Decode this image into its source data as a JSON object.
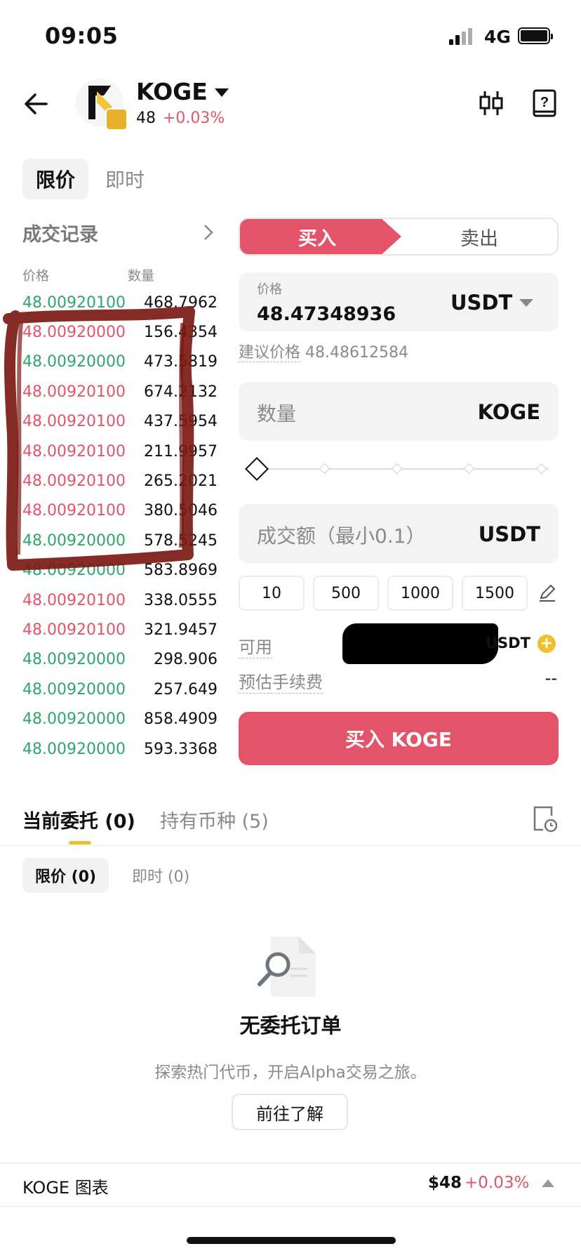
{
  "status_bar": {
    "time": "09:05",
    "network": "4G"
  },
  "header": {
    "token": "KOGE",
    "price": "48",
    "change": "+0.03%"
  },
  "order_type_tabs": {
    "limit": "限价",
    "market": "即时"
  },
  "trade_records": {
    "title": "成交记录",
    "col_price": "价格",
    "col_qty": "数量",
    "rows": [
      {
        "price": "48.00920100",
        "qty": "468.7962",
        "side": "buy"
      },
      {
        "price": "48.00920000",
        "qty": "156.4354",
        "side": "sell"
      },
      {
        "price": "48.00920000",
        "qty": "473.5819",
        "side": "buy"
      },
      {
        "price": "48.00920100",
        "qty": "674.2132",
        "side": "sell"
      },
      {
        "price": "48.00920100",
        "qty": "437.5954",
        "side": "sell"
      },
      {
        "price": "48.00920100",
        "qty": "211.9957",
        "side": "sell"
      },
      {
        "price": "48.00920100",
        "qty": "265.2021",
        "side": "sell"
      },
      {
        "price": "48.00920100",
        "qty": "380.5046",
        "side": "sell"
      },
      {
        "price": "48.00920000",
        "qty": "578.5245",
        "side": "buy"
      },
      {
        "price": "48.00920000",
        "qty": "583.8969",
        "side": "buy"
      },
      {
        "price": "48.00920100",
        "qty": "338.0555",
        "side": "sell"
      },
      {
        "price": "48.00920100",
        "qty": "321.9457",
        "side": "sell"
      },
      {
        "price": "48.00920000",
        "qty": "298.906",
        "side": "buy"
      },
      {
        "price": "48.00920000",
        "qty": "257.649",
        "side": "buy"
      },
      {
        "price": "48.00920000",
        "qty": "858.4909",
        "side": "buy"
      },
      {
        "price": "48.00920000",
        "qty": "593.3368",
        "side": "buy"
      }
    ]
  },
  "trade_form": {
    "buy_label": "买入",
    "sell_label": "卖出",
    "price_label": "价格",
    "price_value": "48.47348936",
    "price_unit": "USDT",
    "suggest_label": "建议价格",
    "suggest_value": "48.48612584",
    "qty_placeholder": "数量",
    "qty_unit": "KOGE",
    "amount_placeholder": "成交额（最小0.1）",
    "amount_unit": "USDT",
    "presets": [
      "10",
      "500",
      "1000",
      "1500"
    ],
    "available_label": "可用",
    "available_unit": "USDT",
    "fee_label": "预估手续费",
    "fee_value": "--",
    "submit_label": "买入 KOGE",
    "slider_fraction": 0
  },
  "orders": {
    "tab_current": "当前委托 (0)",
    "tab_holdings": "持有币种 (5)",
    "sub_limit": "限价 (0)",
    "sub_market": "即时 (0)",
    "empty_title": "无委托订单",
    "empty_desc": "探索热门代币，开启Alpha交易之旅。",
    "learn_button": "前往了解"
  },
  "chart_bar": {
    "title": "KOGE 图表",
    "price": "$48",
    "change": "+0.03%"
  },
  "colors": {
    "buy": "#2ea66e",
    "sell": "#e3546b",
    "accent": "#f0c02a"
  }
}
